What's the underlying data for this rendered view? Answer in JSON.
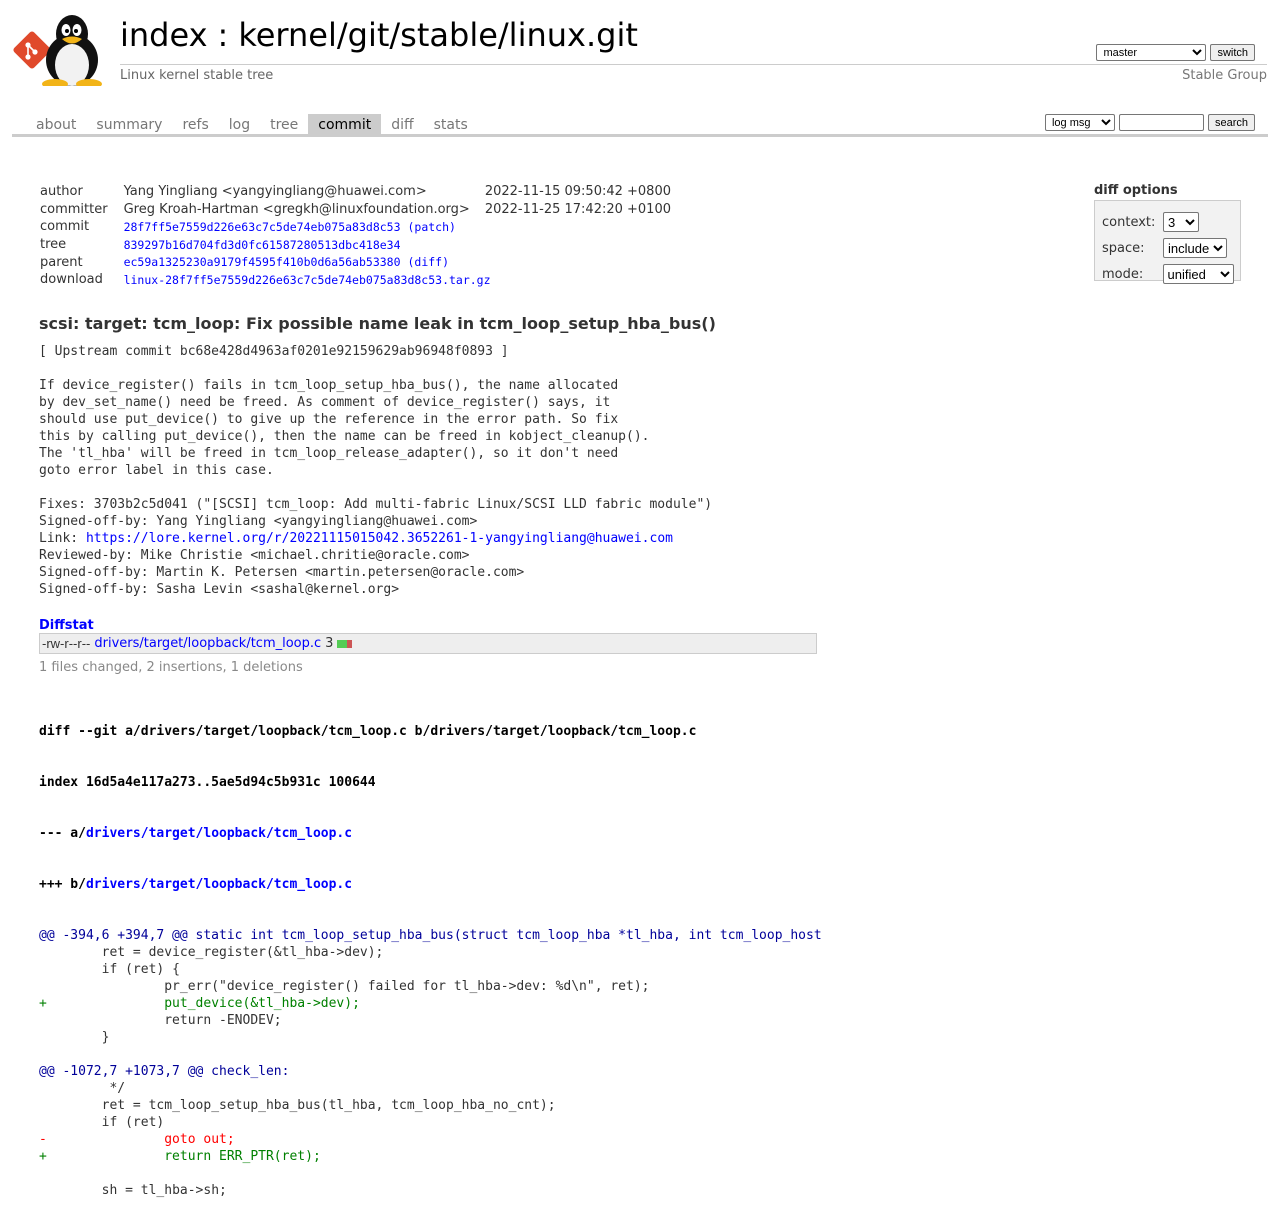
{
  "header": {
    "repo_index": "index",
    "sep": ":",
    "repo_path": "kernel/git/stable/linux.git",
    "description": "Linux kernel stable tree",
    "owner": "Stable Group",
    "branch_selected": "master",
    "switch_label": "switch"
  },
  "tabs": [
    {
      "label": "about"
    },
    {
      "label": "summary"
    },
    {
      "label": "refs"
    },
    {
      "label": "log"
    },
    {
      "label": "tree"
    },
    {
      "label": "commit",
      "active": true
    },
    {
      "label": "diff"
    },
    {
      "label": "stats"
    }
  ],
  "search": {
    "grep_selected": "log msg",
    "query_value": "",
    "button": "search"
  },
  "commit_info": {
    "author_label": "author",
    "author": "Yang Yingliang <yangyingliang@huawei.com>",
    "author_date": "2022-11-15 09:50:42 +0800",
    "committer_label": "committer",
    "committer": "Greg Kroah-Hartman <gregkh@linuxfoundation.org>",
    "committer_date": "2022-11-25 17:42:20 +0100",
    "commit_label": "commit",
    "commit": "28f7ff5e7559d226e63c7c5de74eb075a83d8c53",
    "commit_patch": "(patch)",
    "tree_label": "tree",
    "tree": "839297b16d704fd3d0fc61587280513dbc418e34",
    "parent_label": "parent",
    "parent": "ec59a1325230a9179f4595f410b0d6a56ab53380",
    "parent_diff": "(diff)",
    "download_label": "download",
    "download": "linux-28f7ff5e7559d226e63c7c5de74eb075a83d8c53.tar.gz"
  },
  "diff_options": {
    "title": "diff options",
    "context_label": "context:",
    "context_value": "3",
    "space_label": "space:",
    "space_value": "include",
    "mode_label": "mode:",
    "mode_value": "unified"
  },
  "message": {
    "subject": "scsi: target: tcm_loop: Fix possible name leak in tcm_loop_setup_hba_bus()",
    "body_before_link": "[ Upstream commit bc68e428d4963af0201e92159629ab96948f0893 ]\n\nIf device_register() fails in tcm_loop_setup_hba_bus(), the name allocated\nby dev_set_name() need be freed. As comment of device_register() says, it\nshould use put_device() to give up the reference in the error path. So fix\nthis by calling put_device(), then the name can be freed in kobject_cleanup().\nThe 'tl_hba' will be freed in tcm_loop_release_adapter(), so it don't need\ngoto error label in this case.\n\nFixes: 3703b2c5d041 (\"[SCSI] tcm_loop: Add multi-fabric Linux/SCSI LLD fabric module\")\nSigned-off-by: Yang Yingliang <yangyingliang@huawei.com>\nLink: ",
    "link": "https://lore.kernel.org/r/20221115015042.3652261-1-yangyingliang@huawei.com",
    "body_after_link": "\nReviewed-by: Mike Christie <michael.chritie@oracle.com>\nSigned-off-by: Martin K. Petersen <martin.petersen@oracle.com>\nSigned-off-by: Sasha Levin <sashal@kernel.org>"
  },
  "diffstat": {
    "title": "Diffstat",
    "mode": "-rw-r--r--",
    "file": "drivers/target/loopback/tcm_loop.c",
    "count": "3",
    "summary": "1 files changed, 2 insertions, 1 deletions",
    "insertions": 2,
    "deletions": 1
  },
  "diff": {
    "line1": "diff --git a/drivers/target/loopback/tcm_loop.c b/drivers/target/loopback/tcm_loop.c",
    "line2": "index 16d5a4e117a273..5ae5d94c5b931c 100644",
    "line3_prefix": "--- a/",
    "line3_path": "drivers/target/loopback/tcm_loop.c",
    "line4_prefix": "+++ b/",
    "line4_path": "drivers/target/loopback/tcm_loop.c",
    "lines": [
      {
        "type": "hunk",
        "text": "@@ -394,6 +394,7 @@ static int tcm_loop_setup_hba_bus(struct tcm_loop_hba *tl_hba, int tcm_loop_host"
      },
      {
        "type": "ctx",
        "text": " \tret = device_register(&tl_hba->dev);"
      },
      {
        "type": "ctx",
        "text": " \tif (ret) {"
      },
      {
        "type": "ctx",
        "text": " \t\tpr_err(\"device_register() failed for tl_hba->dev: %d\\n\", ret);"
      },
      {
        "type": "add",
        "text": "+\t\tput_device(&tl_hba->dev);"
      },
      {
        "type": "ctx",
        "text": " \t\treturn -ENODEV;"
      },
      {
        "type": "ctx",
        "text": " \t}"
      },
      {
        "type": "ctx",
        "text": " "
      },
      {
        "type": "hunk",
        "text": "@@ -1072,7 +1073,7 @@ check_len:"
      },
      {
        "type": "ctx",
        "text": " \t */"
      },
      {
        "type": "ctx",
        "text": " \tret = tcm_loop_setup_hba_bus(tl_hba, tcm_loop_hba_no_cnt);"
      },
      {
        "type": "ctx",
        "text": " \tif (ret)"
      },
      {
        "type": "del",
        "text": "-\t\tgoto out;"
      },
      {
        "type": "add",
        "text": "+\t\treturn ERR_PTR(ret);"
      },
      {
        "type": "ctx",
        "text": " "
      },
      {
        "type": "ctx",
        "text": " \tsh = tl_hba->sh;"
      }
    ]
  },
  "colors": {
    "link": "#0000ff",
    "add": "#008000",
    "del": "#ff0000",
    "hunk": "#000099",
    "tab_active_bg": "#cccccc"
  },
  "icons": {
    "logo": "tux-penguin-with-git-logo-icon"
  }
}
